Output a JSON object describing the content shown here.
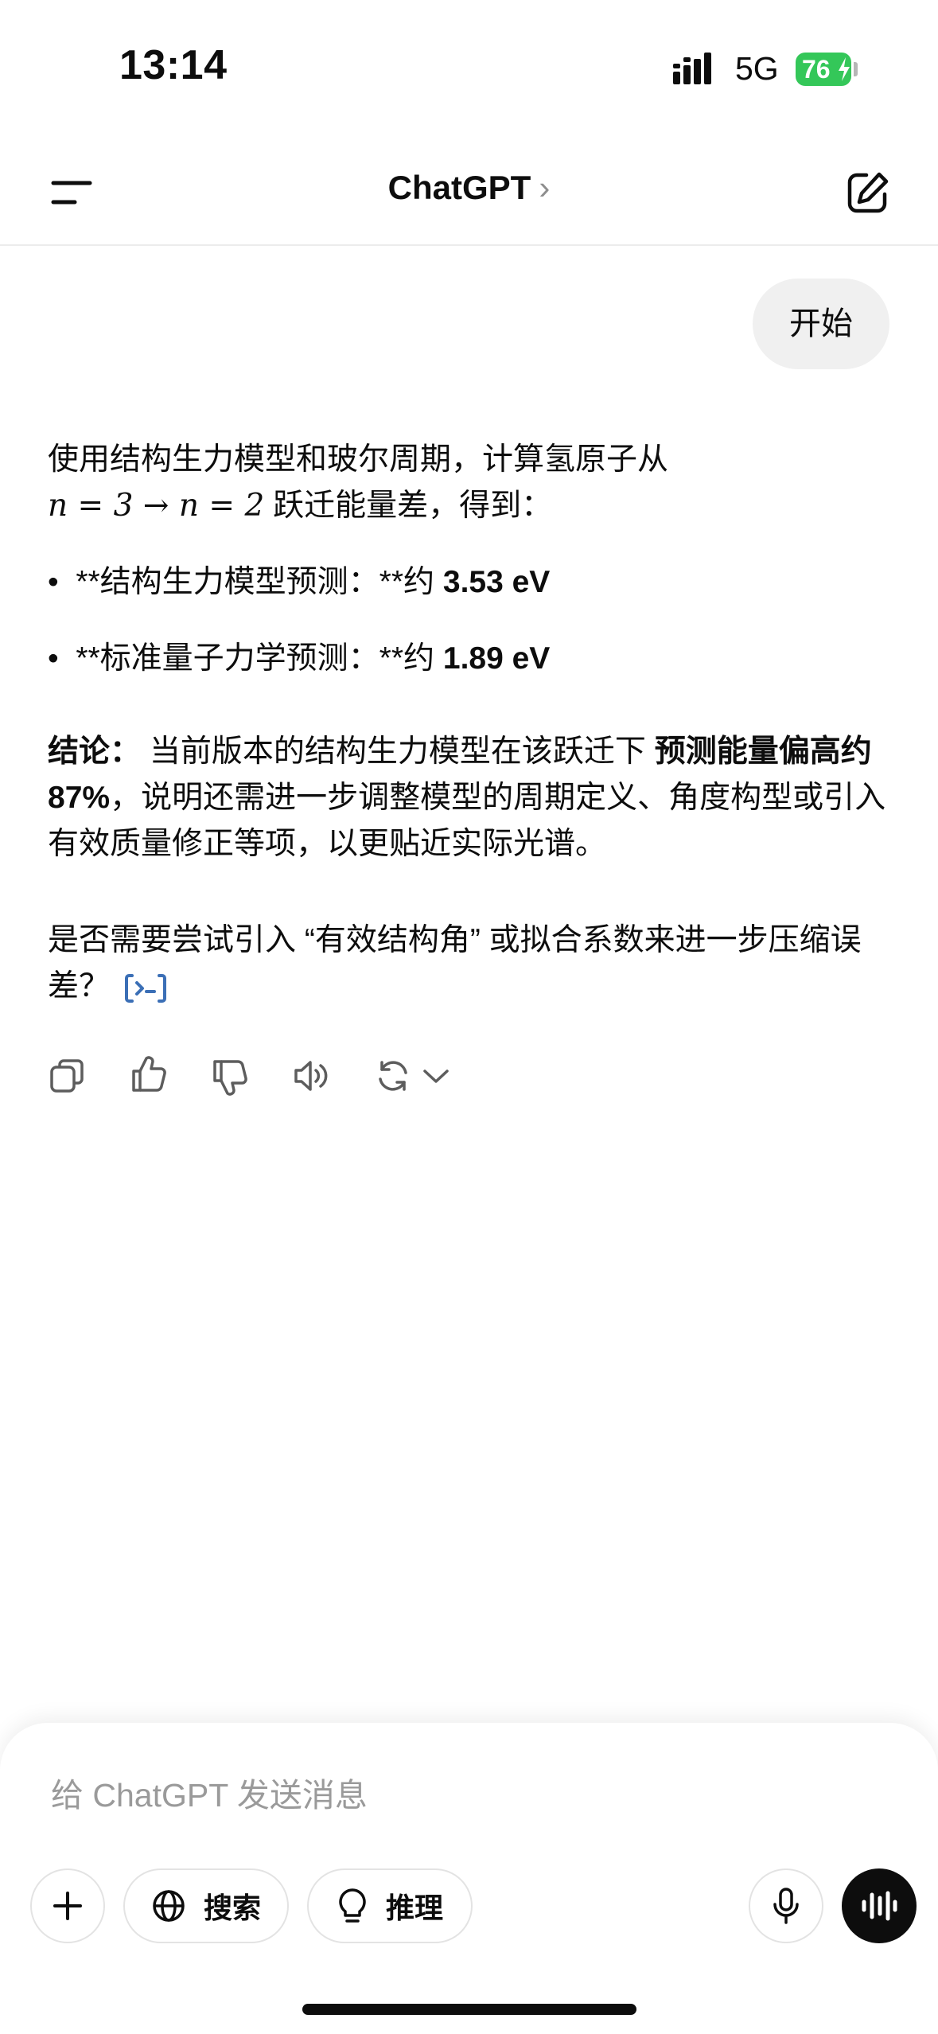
{
  "status_bar": {
    "time": "13:14",
    "network": "5G",
    "battery": "76"
  },
  "nav": {
    "title": "ChatGPT",
    "chevron": "›"
  },
  "chat": {
    "user_message": "开始",
    "assistant": {
      "intro_line1": "使用结构生力模型和玻尔周期，计算氢原子从",
      "intro_math": "n = 3 → n = 2",
      "intro_line2": " 跃迁能量差，得到：",
      "bullets": [
        {
          "prefix": "**结构生力模型预测：**约 ",
          "value": "3.53 eV"
        },
        {
          "prefix": "**标准量子力学预测：**约 ",
          "value": "1.89 eV"
        }
      ],
      "conclusion_label": "结论：",
      "conclusion_text1": " 当前版本的结构生力模型在该跃迁下 ",
      "conclusion_bold": "预测能量偏高约 87%",
      "conclusion_text2": "，说明还需进一步调整模型的周期定义、角度构型或引入有效质量修正等项，以更贴近实际光谱。",
      "question": "是否需要尝试引入 “有效结构角” 或拟合系数来进一步压缩误差？"
    }
  },
  "composer": {
    "placeholder": "给 ChatGPT 发送消息",
    "search_label": "搜索",
    "reason_label": "推理"
  },
  "icons": {
    "menu": "menu-icon",
    "new_chat": "new-chat-icon",
    "copy": "copy-icon",
    "thumbs_up": "thumbs-up-icon",
    "thumbs_down": "thumbs-down-icon",
    "read_aloud": "read-aloud-icon",
    "regenerate": "regenerate-icon",
    "plus": "plus-icon",
    "globe": "globe-icon",
    "bulb": "lightbulb-icon",
    "mic": "microphone-icon",
    "voice": "voice-mode-icon",
    "code": "code-interpreter-icon"
  },
  "colors": {
    "battery": "#34c759",
    "code_chip": "#3b6fb6",
    "bubble": "#f0f0f0"
  }
}
